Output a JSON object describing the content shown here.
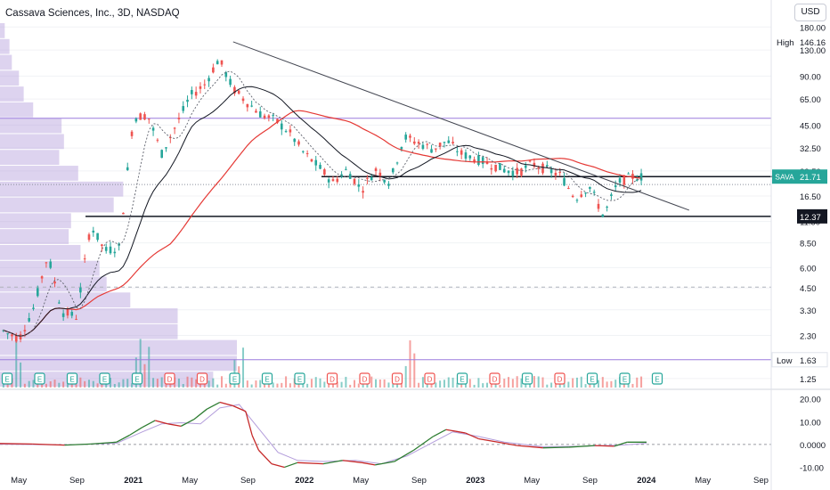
{
  "header": {
    "title": "Cassava Sciences, Inc., 3D, NASDAQ",
    "currency": "USD"
  },
  "colors": {
    "candle_up": "#26a69a",
    "candle_down": "#ef5350",
    "ma_slow": "#e53935",
    "ma_mid": "#131722",
    "volume_profile": "#b39ddb",
    "sava_badge": "#26a69a",
    "support_badge": "#131722",
    "macd_signal": "#b39ddb",
    "horizontal_lines": "#9c7cde"
  },
  "chart_data": [
    {
      "type": "candlestick",
      "title": "Cassava Sciences, Inc., 3D, NASDAQ",
      "y_scale": "log",
      "ylim": [
        1.1,
        190
      ],
      "y_ticks": [
        "180.00",
        "130.00",
        "90.00",
        "65.00",
        "45.00",
        "32.50",
        "23.50",
        "16.50",
        "11.50",
        "8.50",
        "6.00",
        "4.50",
        "3.30",
        "2.30",
        "1.25"
      ],
      "x_ticks": [
        "May",
        "Sep",
        "2021",
        "May",
        "Sep",
        "2022",
        "May",
        "Sep",
        "2023",
        "May",
        "Sep",
        "2024",
        "May",
        "Sep"
      ],
      "price_path": [
        [
          "2020-03",
          2.9
        ],
        [
          "2020-04",
          2.4
        ],
        [
          "2020-05",
          2.2
        ],
        [
          "2020-06",
          3.4
        ],
        [
          "2020-07",
          7.2
        ],
        [
          "2020-08",
          3.2
        ],
        [
          "2020-09",
          3.0
        ],
        [
          "2020-10",
          11.0
        ],
        [
          "2020-11",
          7.6
        ],
        [
          "2020-12",
          8.0
        ],
        [
          "2021-01",
          50.0
        ],
        [
          "2021-02",
          52.0
        ],
        [
          "2021-03",
          30.0
        ],
        [
          "2021-04",
          45.0
        ],
        [
          "2021-05",
          68.0
        ],
        [
          "2021-06",
          80.0
        ],
        [
          "2021-07",
          115.0
        ],
        [
          "2021-08",
          75.0
        ],
        [
          "2021-09",
          62.0
        ],
        [
          "2021-10",
          52.0
        ],
        [
          "2021-11",
          48.0
        ],
        [
          "2021-12",
          40.0
        ],
        [
          "2022-01",
          30.0
        ],
        [
          "2022-02",
          25.0
        ],
        [
          "2022-03",
          20.0
        ],
        [
          "2022-04",
          24.0
        ],
        [
          "2022-05",
          18.0
        ],
        [
          "2022-06",
          24.0
        ],
        [
          "2022-07",
          20.0
        ],
        [
          "2022-08",
          38.0
        ],
        [
          "2022-09",
          35.0
        ],
        [
          "2022-10",
          32.0
        ],
        [
          "2022-11",
          36.0
        ],
        [
          "2022-12",
          30.0
        ],
        [
          "2023-01",
          28.0
        ],
        [
          "2023-02",
          26.0
        ],
        [
          "2023-03",
          24.0
        ],
        [
          "2023-04",
          23.0
        ],
        [
          "2023-05",
          26.0
        ],
        [
          "2023-06",
          24.0
        ],
        [
          "2023-07",
          22.0
        ],
        [
          "2023-08",
          16.0
        ],
        [
          "2023-09",
          19.0
        ],
        [
          "2023-10",
          12.4
        ],
        [
          "2023-11",
          20.0
        ],
        [
          "2023-12",
          21.71
        ]
      ],
      "series": [
        {
          "name": "SAVA",
          "last": "21.71"
        }
      ],
      "annotations": [
        {
          "label": "High",
          "value": "146.16"
        },
        {
          "label": "Low",
          "value": "1.63"
        },
        {
          "label": "",
          "value": "12.37"
        }
      ],
      "levels": [
        {
          "value": 49.5,
          "style": "purple"
        },
        {
          "value": 21.71,
          "style": "solid"
        },
        {
          "value": 19.4,
          "style": "dotted"
        },
        {
          "value": 12.37,
          "style": "solid"
        },
        {
          "value": 4.55,
          "style": "dashed"
        },
        {
          "value": 1.63,
          "style": "purple"
        }
      ],
      "trendline": {
        "from": [
          "2021-08",
          146
        ],
        "to": [
          "2024-04",
          13.5
        ]
      },
      "volume_profile": {
        "bins_low_to_high": [
          0.9,
          1.0,
          1.0,
          0.75,
          0.75,
          0.55,
          0.45,
          0.42,
          0.34,
          0.29,
          0.3,
          0.48,
          0.52,
          0.33,
          0.25,
          0.27,
          0.26,
          0.14,
          0.1,
          0.08,
          0.05,
          0.04,
          0.02
        ]
      },
      "events": [
        "E",
        "E",
        "E",
        "E",
        "E",
        "D",
        "D",
        "E",
        "E",
        "E",
        "D",
        "D",
        "D",
        "D",
        "E",
        "D",
        "E",
        "D",
        "E",
        "E",
        "E"
      ]
    },
    {
      "type": "line",
      "title": "",
      "ylim": [
        -11,
        23
      ],
      "y_ticks": [
        "20.00",
        "10.00",
        "0.0000",
        "-10.00"
      ],
      "series": [
        {
          "name": "",
          "points": [
            [
              0,
              0.4
            ],
            [
              0.05,
              0.2
            ],
            [
              0.1,
              -0.3
            ],
            [
              0.14,
              0.2
            ],
            [
              0.18,
              1.0
            ],
            [
              0.2,
              4.0
            ],
            [
              0.22,
              7.5
            ],
            [
              0.24,
              10.5
            ],
            [
              0.26,
              9.0
            ],
            [
              0.28,
              8.0
            ],
            [
              0.3,
              11.0
            ],
            [
              0.32,
              15.5
            ],
            [
              0.34,
              18.5
            ],
            [
              0.36,
              17.0
            ],
            [
              0.38,
              14.5
            ],
            [
              0.39,
              4.0
            ],
            [
              0.4,
              -2.5
            ],
            [
              0.42,
              -8.5
            ],
            [
              0.44,
              -10.0
            ],
            [
              0.46,
              -8.0
            ],
            [
              0.5,
              -8.5
            ],
            [
              0.53,
              -7.0
            ],
            [
              0.56,
              -8.0
            ],
            [
              0.58,
              -9.0
            ],
            [
              0.61,
              -7.5
            ],
            [
              0.64,
              -2.5
            ],
            [
              0.67,
              3.5
            ],
            [
              0.69,
              6.5
            ],
            [
              0.72,
              5.0
            ],
            [
              0.74,
              2.5
            ],
            [
              0.77,
              1.0
            ],
            [
              0.8,
              -0.5
            ],
            [
              0.84,
              -1.5
            ],
            [
              0.88,
              -1.2
            ],
            [
              0.92,
              -0.5
            ],
            [
              0.95,
              -0.8
            ],
            [
              0.97,
              1.0
            ],
            [
              1.0,
              1.0
            ]
          ]
        },
        {
          "name": "",
          "points": [
            [
              0,
              0.1
            ],
            [
              0.1,
              -0.2
            ],
            [
              0.18,
              0.5
            ],
            [
              0.22,
              5.5
            ],
            [
              0.25,
              9.0
            ],
            [
              0.28,
              9.5
            ],
            [
              0.31,
              9.0
            ],
            [
              0.34,
              16.0
            ],
            [
              0.37,
              17.5
            ],
            [
              0.4,
              7.0
            ],
            [
              0.43,
              -3.5
            ],
            [
              0.46,
              -7.0
            ],
            [
              0.5,
              -7.5
            ],
            [
              0.55,
              -7.0
            ],
            [
              0.59,
              -8.5
            ],
            [
              0.63,
              -5.0
            ],
            [
              0.67,
              1.0
            ],
            [
              0.7,
              5.5
            ],
            [
              0.74,
              3.5
            ],
            [
              0.78,
              1.0
            ],
            [
              0.84,
              -1.0
            ],
            [
              0.9,
              -0.8
            ],
            [
              0.96,
              -0.3
            ],
            [
              1.0,
              0.5
            ]
          ]
        }
      ]
    }
  ]
}
